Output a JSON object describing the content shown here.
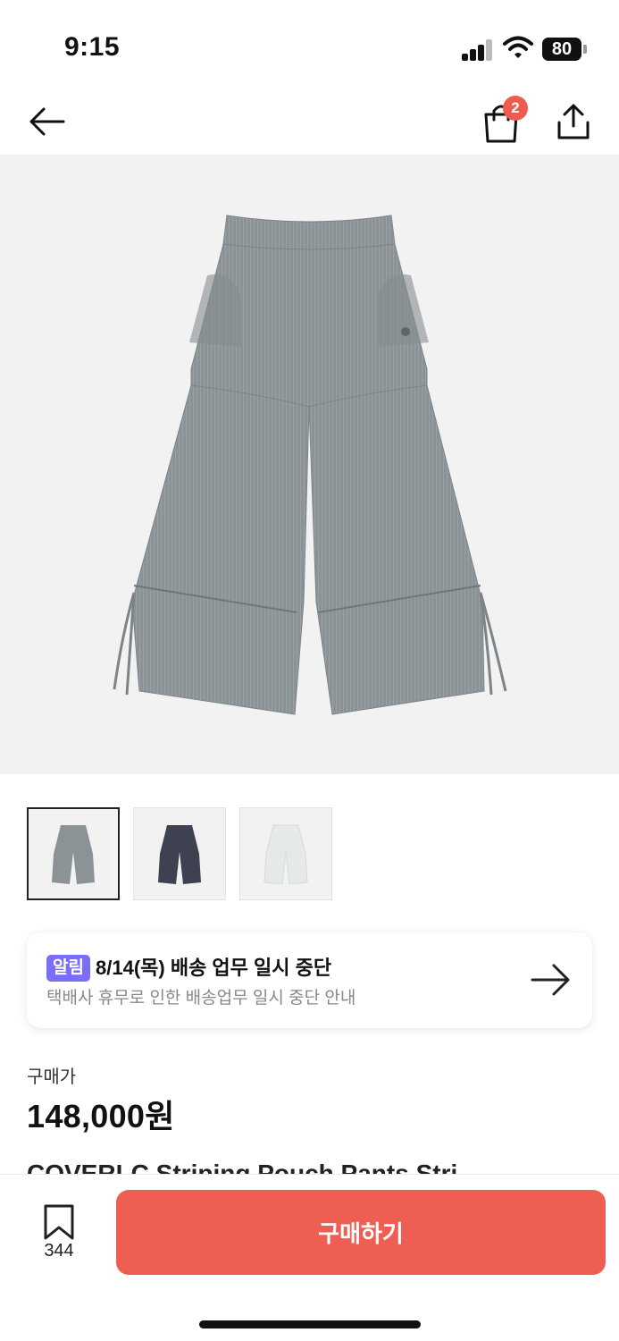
{
  "status_bar": {
    "time": "9:15",
    "battery": "80"
  },
  "nav": {
    "cart_count": "2"
  },
  "product": {
    "image_alt": "회색 스트라이프 와이드 팬츠",
    "selected_thumbnail": 0,
    "thumbnails": [
      {
        "color": "#8c9396"
      },
      {
        "color": "#3e4250"
      },
      {
        "color": "#e6e9ea"
      }
    ]
  },
  "notice": {
    "badge": "알림",
    "title": "8/14(목) 배송 업무 일시 중단",
    "subtitle": "택배사 휴무로 인한 배송업무 일시 중단 안내"
  },
  "price": {
    "label": "구매가",
    "value": "148,000원"
  },
  "product_title_peek": "COVERLC Striping Pouch Pants Stri",
  "bottom_bar": {
    "bookmark_count": "344",
    "buy_label": "구매하기"
  },
  "colors": {
    "accent": "#ef5e52",
    "badge": "#7b6ef6",
    "pants_gray": "#8c9396"
  }
}
